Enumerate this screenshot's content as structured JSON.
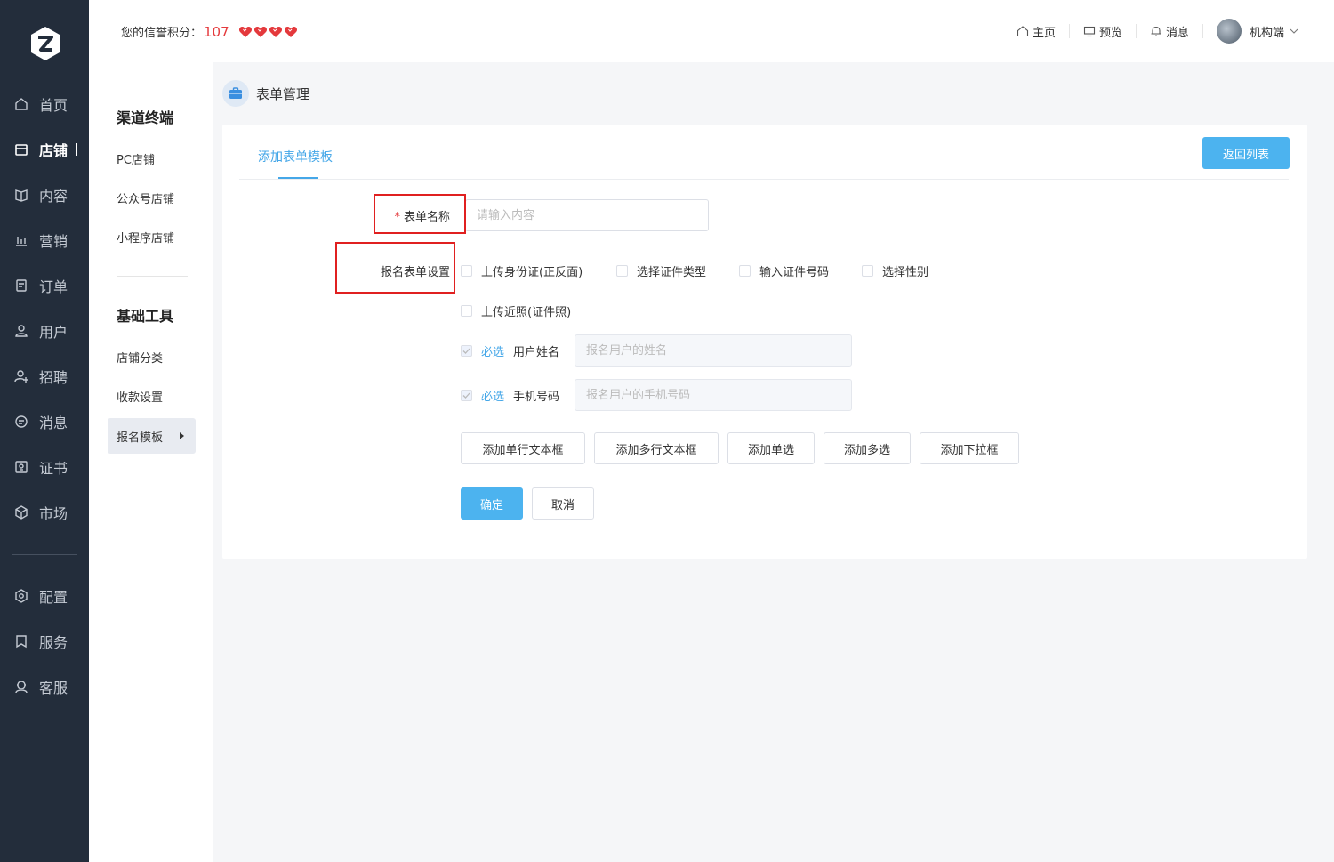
{
  "nav": {
    "items": [
      {
        "label": "首页",
        "icon": "home-icon"
      },
      {
        "label": "店铺",
        "icon": "store-icon"
      },
      {
        "label": "内容",
        "icon": "book-icon"
      },
      {
        "label": "营销",
        "icon": "chart-icon"
      },
      {
        "label": "订单",
        "icon": "order-icon"
      },
      {
        "label": "用户",
        "icon": "user-icon"
      },
      {
        "label": "招聘",
        "icon": "recruit-icon"
      },
      {
        "label": "消息",
        "icon": "message-icon"
      },
      {
        "label": "证书",
        "icon": "certificate-icon"
      },
      {
        "label": "市场",
        "icon": "market-icon"
      },
      {
        "label": "配置",
        "icon": "gear-icon"
      },
      {
        "label": "服务",
        "icon": "bookmark-icon"
      },
      {
        "label": "客服",
        "icon": "support-icon"
      }
    ],
    "active": "店铺"
  },
  "topbar": {
    "credit_label": "您的信誉积分：",
    "credit_score": "107",
    "hearts": 4,
    "links": [
      {
        "label": "主页",
        "icon": "home-icon"
      },
      {
        "label": "预览",
        "icon": "monitor-icon"
      },
      {
        "label": "消息",
        "icon": "bell-icon"
      }
    ],
    "user_name": "机构端"
  },
  "submenu": {
    "group1_title": "渠道终端",
    "group1_items": [
      "PC店铺",
      "公众号店铺",
      "小程序店铺"
    ],
    "group2_title": "基础工具",
    "group2_items": [
      "店铺分类",
      "收款设置",
      "报名模板"
    ],
    "active": "报名模板"
  },
  "breadcrumb": {
    "title": "表单管理"
  },
  "card": {
    "tab_label": "添加表单模板",
    "back_button": "返回列表",
    "form": {
      "name_label": "表单名称",
      "name_placeholder": "请输入内容",
      "setting_label": "报名表单设置",
      "options": [
        {
          "label": "上传身份证(正反面)",
          "checked": false
        },
        {
          "label": "选择证件类型",
          "checked": false
        },
        {
          "label": "输入证件号码",
          "checked": false
        },
        {
          "label": "选择性别",
          "checked": false
        },
        {
          "label": "上传近照(证件照)",
          "checked": false
        }
      ],
      "fixed_fields": [
        {
          "tag": "必选",
          "label": "用户姓名",
          "placeholder": "报名用户的姓名"
        },
        {
          "tag": "必选",
          "label": "手机号码",
          "placeholder": "报名用户的手机号码"
        }
      ],
      "add_buttons": [
        "添加单行文本框",
        "添加多行文本框",
        "添加单选",
        "添加多选",
        "添加下拉框"
      ],
      "confirm": "确定",
      "cancel": "取消"
    }
  },
  "colors": {
    "sidebar": "#232d3b",
    "accent": "#4cb3ef",
    "link": "#45a7e8",
    "highlight": "#e02020",
    "heart": "#e4393c"
  }
}
